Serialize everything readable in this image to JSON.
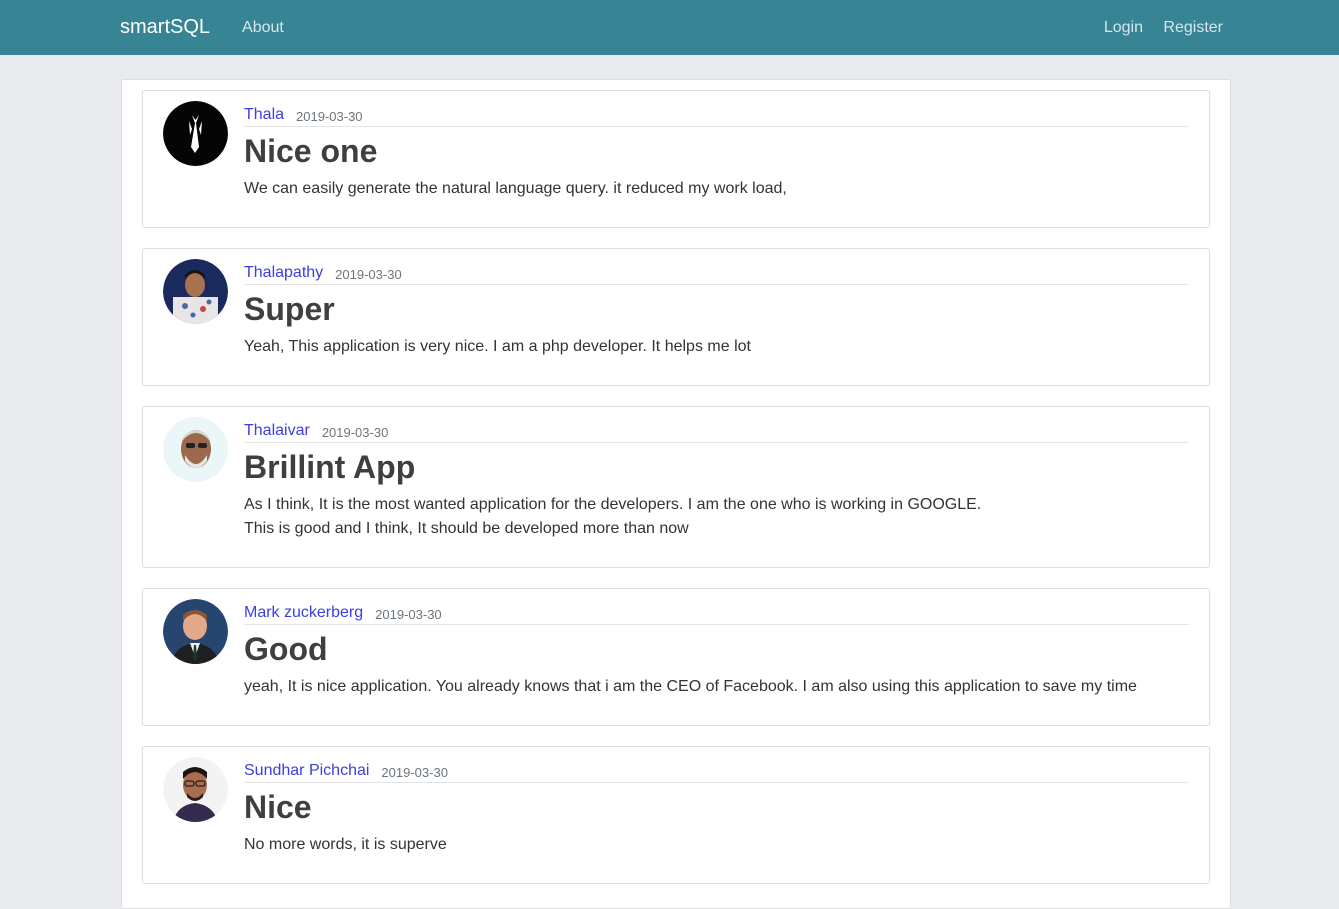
{
  "nav": {
    "brand": "smartSQL",
    "about": "About",
    "login": "Login",
    "register": "Register"
  },
  "posts": [
    {
      "author": "Thala",
      "date": "2019-03-30",
      "title": "Nice one",
      "content": "We can easily generate the natural language query. it reduced my work load,"
    },
    {
      "author": "Thalapathy",
      "date": "2019-03-30",
      "title": "Super",
      "content": "Yeah, This application is very nice. I am a php developer. It helps me lot"
    },
    {
      "author": "Thalaivar",
      "date": "2019-03-30",
      "title": "Brillint App",
      "content": "As I think, It is the most wanted application for the developers. I am the one who is working in GOOGLE.\nThis is good and I think, It should be developed more than now"
    },
    {
      "author": "Mark zuckerberg",
      "date": "2019-03-30",
      "title": "Good",
      "content": "yeah, It is nice application. You already knows that i am the CEO of Facebook. I am also using this application to save my time"
    },
    {
      "author": "Sundhar Pichchai",
      "date": "2019-03-30",
      "title": "Nice",
      "content": "No more words, it is superve"
    }
  ]
}
